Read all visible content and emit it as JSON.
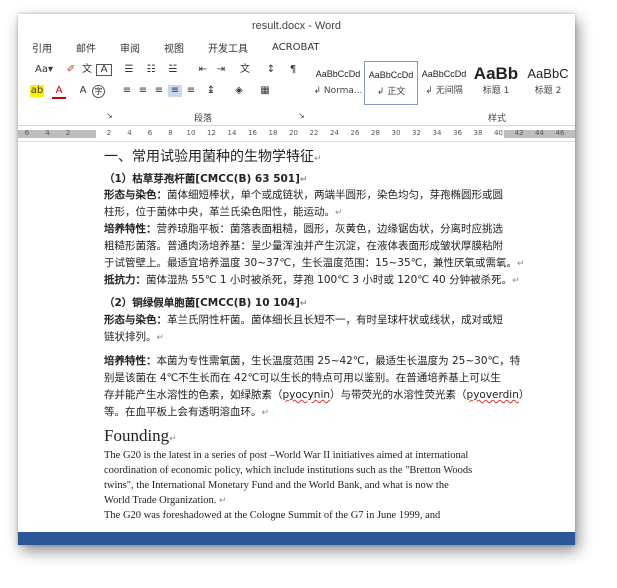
{
  "window": {
    "title": "result.docx - Word"
  },
  "tabs": [
    "引用",
    "邮件",
    "审阅",
    "视图",
    "开发工具",
    "ACROBAT"
  ],
  "ribbon": {
    "font_size_label": "Aa",
    "style_gallery": [
      {
        "sample": "AaBbCcDd",
        "name": "↲ Norma..."
      },
      {
        "sample": "AaBbCcDd",
        "name": "↲ 正文"
      },
      {
        "sample": "AaBbCcDd",
        "name": "↲ 无间隔"
      },
      {
        "sample": "AaBb",
        "name": "标题 1"
      },
      {
        "sample": "AaBbC",
        "name": "标题 2"
      }
    ],
    "group_paragraph": "段落",
    "group_styles": "样式"
  },
  "ruler": {
    "ticks": [
      "6",
      "4",
      "2",
      "",
      "2",
      "4",
      "6",
      "8",
      "10",
      "12",
      "14",
      "16",
      "18",
      "20",
      "22",
      "24",
      "26",
      "28",
      "30",
      "32",
      "34",
      "36",
      "38",
      "40",
      "42",
      "44",
      "46"
    ]
  },
  "doc": {
    "heading": "一、常用试验用菌种的生物学特征",
    "s1_title": "（1）枯草芽孢杆菌[CMCC(B) 63 501]",
    "s1_l1_label": "形态与染色：",
    "s1_l1": "菌体细短棒状，单个或成链状，两端半圆形，染色均匀，芽孢椭圆形或圆",
    "s1_l2": "柱形，位于菌体中央，革兰氏染色阳性，能运动。",
    "s1_l3_label": "培养特性：",
    "s1_l3": "营养琼脂平板：菌落表面粗糙，圆形，灰黄色，边缘锯齿状，分离时应挑选",
    "s1_l4": "粗糙形菌落。普通肉汤培养基：呈少量浑浊并产生沉淀，在液体表面形成皱状厚膜粘附",
    "s1_l5": "于试管壁上。最适宜培养温度 30~37℃，生长温度范围：15~35℃，兼性厌氧或需氧。",
    "s1_l6_label": "抵抗力：",
    "s1_l6": "菌体湿热 55℃ 1 小时被杀死，芽孢 100℃ 3 小时或 120℃ 40 分钟被杀死。",
    "s2_title": "（2）铜绿假单胞菌[CMCC(B) 10 104]",
    "s2_l1_label": "形态与染色：",
    "s2_l1": "革兰氏阴性杆菌。菌体细长且长短不一，有时呈球杆状或线状，成对或短",
    "s2_l2": "链状排列。",
    "s2_l3_label": "培养特性：",
    "s2_l3": "本菌为专性需氧菌，生长温度范围 25~42℃，最适生长温度为 25~30℃，特",
    "s2_l4": "别是该菌在 4℃不生长而在 42℃可以生长的特点可用以鉴别。在普通培养基上可以生",
    "s2_l5_a": "存并能产生水溶性的色素，如绿脓素（",
    "s2_l5_b": "pyocynin",
    "s2_l5_c": "）与带荧光的水溶性荧光素（",
    "s2_l5_d": "pyoverdin",
    "s2_l5_e": "）",
    "s2_l6": "等。在血平板上会有透明溶血环。",
    "founding": "Founding",
    "en_l1": "The G20 is the latest in a series of post –World War II initiatives aimed at international",
    "en_l2": "coordination of economic policy, which include institutions such as the \"Bretton Woods",
    "en_l3": "twins\", the International Monetary Fund and the World Bank, and what is now the",
    "en_l4": "World Trade Organization.",
    "en_l5": "The G20 was foreshadowed at the Cologne Summit of the G7 in June 1999, and"
  },
  "colors": {
    "accent": "#2b579a"
  }
}
